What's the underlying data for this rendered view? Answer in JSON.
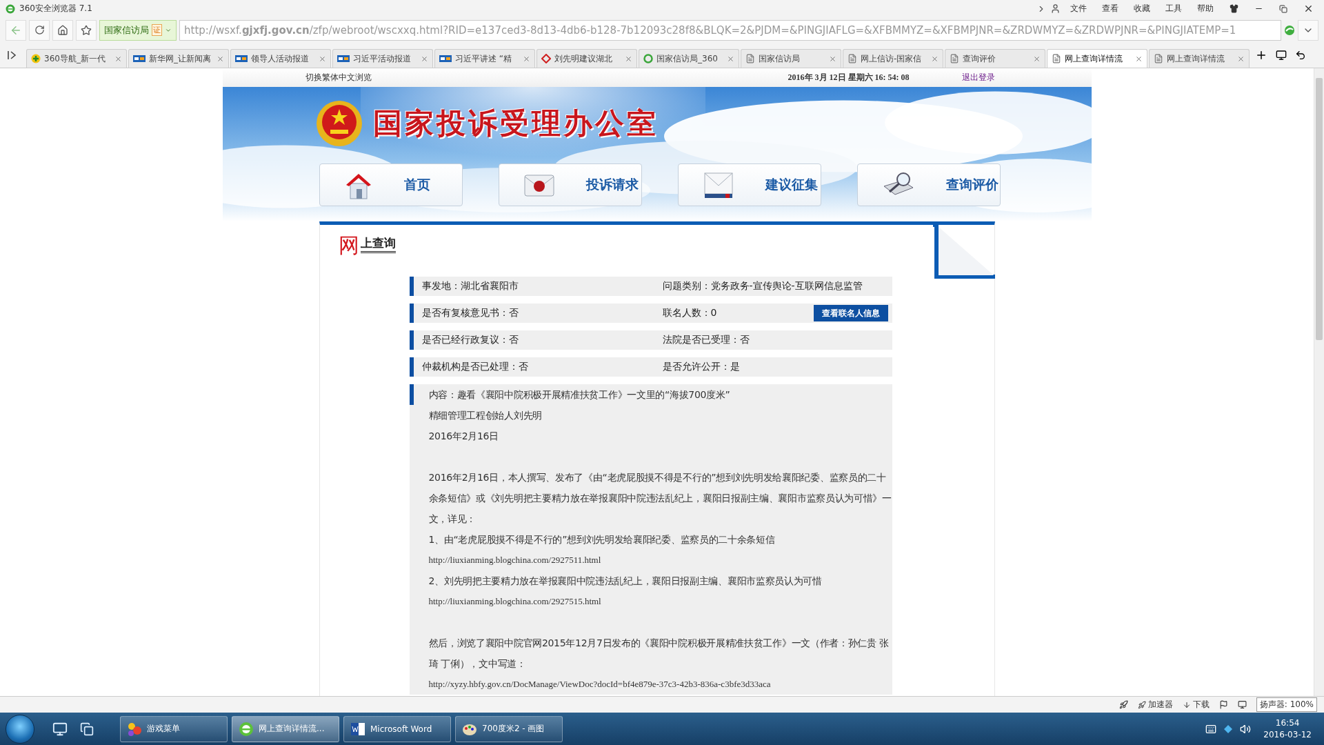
{
  "browser": {
    "title": "360安全浏览器 7.1",
    "menu": [
      "文件",
      "查看",
      "收藏",
      "工具",
      "帮助"
    ],
    "site_badge": "国家信访局",
    "cert": "证",
    "url": "http://wsxf.**gjxfj.gov.cn**/zfp/webroot/wscxxq.html?RID=e137ced3-8d13-4db6-b128-7b12093c28f8&BLQK=2&PJDM=&PINGJIAFLG=&XFBMMYZ=&XFBMPJNR=&ZRDWMYZ=&ZRDWPJNR=&PINGJIATEMP=1"
  },
  "tabs": [
    {
      "label": "360导航_新一代",
      "kind": "plus",
      "selected": false
    },
    {
      "label": "新华网_让新闻离",
      "kind": "news",
      "selected": false
    },
    {
      "label": "领导人活动报道",
      "kind": "news",
      "selected": false
    },
    {
      "label": "习近平活动报道",
      "kind": "news",
      "selected": false
    },
    {
      "label": "习近平讲述 “精",
      "kind": "news",
      "selected": false
    },
    {
      "label": "刘先明建议湖北",
      "kind": "diamond",
      "selected": false
    },
    {
      "label": "国家信访局_360",
      "kind": "ring",
      "selected": false
    },
    {
      "label": "国家信访局",
      "kind": "page",
      "selected": false
    },
    {
      "label": "网上信访-国家信",
      "kind": "page",
      "selected": false
    },
    {
      "label": "查询评价",
      "kind": "page",
      "selected": false
    },
    {
      "label": "网上查询详情流",
      "kind": "page",
      "selected": true
    },
    {
      "label": "网上查询详情流",
      "kind": "page",
      "selected": false
    }
  ],
  "page": {
    "traditional_link": "切换繁体中文浏览",
    "datetime": "2016年 3月 12日 星期六 16: 54: 08",
    "logout": "退出登录",
    "site_title": "国家投诉受理办公室",
    "nav": [
      {
        "label": "首页",
        "kind": "home"
      },
      {
        "label": "投诉请求",
        "kind": "seal"
      },
      {
        "label": "建议征集",
        "kind": "mail"
      },
      {
        "label": "查询评价",
        "kind": "search"
      }
    ],
    "section_mark": "网",
    "section_title": "上查询",
    "info_rows": [
      {
        "left": "事发地：湖北省襄阳市",
        "right": "问题类别：党务政务-宣传舆论-互联网信息监管"
      },
      {
        "left": "是否有复核意见书：否",
        "right": "联名人数：0",
        "button": "查看联名人信息"
      },
      {
        "left": "是否已经行政复议：否",
        "right": "法院是否已受理：否"
      },
      {
        "left": "仲裁机构是否已处理：否",
        "right": "是否允许公开：是"
      }
    ],
    "content": [
      {
        "kind": "text",
        "text": "内容：趣看《襄阳中院积极开展精准扶贫工作》一文里的“海拔700度米”"
      },
      {
        "kind": "text",
        "text": "精细管理工程创始人刘先明"
      },
      {
        "kind": "text",
        "text": "2016年2月16日"
      },
      {
        "kind": "gap"
      },
      {
        "kind": "text",
        "text": "2016年2月16日，本人撰写、发布了《由“老虎屁股摸不得是不行的”想到刘先明发给襄阳纪委、监察员的二十余条短信》或《刘先明把主要精力放在举报襄阳中院违法乱纪上，襄阳日报副主编、襄阳市监察员认为可惜》一文，详见："
      },
      {
        "kind": "text",
        "text": "1、由“老虎屁股摸不得是不行的”想到刘先明发给襄阳纪委、监察员的二十余条短信"
      },
      {
        "kind": "link",
        "text": "http://liuxianming.blogchina.com/2927511.html"
      },
      {
        "kind": "text",
        "text": "2、刘先明把主要精力放在举报襄阳中院违法乱纪上，襄阳日报副主编、襄阳市监察员认为可惜"
      },
      {
        "kind": "link",
        "text": "http://liuxianming.blogchina.com/2927515.html"
      },
      {
        "kind": "gap"
      },
      {
        "kind": "text",
        "text": "然后，浏览了襄阳中院官网2015年12月7日发布的《襄阳中院积极开展精准扶贫工作》一文（作者：孙仁贵 张琦 丁俐），文中写道："
      },
      {
        "kind": "link",
        "text": "http://xyzy.hbfy.gov.cn/DocManage/ViewDoc?docId=bf4e879e-37c3-42b3-836a-c3bfe3d33aca"
      }
    ]
  },
  "status_bar": {
    "accelerator": "加速器",
    "download": "下载",
    "volume": "扬声器: 100%"
  },
  "taskbar": {
    "items": [
      {
        "label": "游戏菜单",
        "kind": "game",
        "selected": false
      },
      {
        "label": "网上查询详情流...",
        "kind": "browser",
        "selected": true
      },
      {
        "label": "Microsoft Word",
        "kind": "word",
        "selected": false
      },
      {
        "label": "700度米2 - 画图",
        "kind": "paint",
        "selected": false
      }
    ],
    "time": "16:54",
    "date": "2016-03-12"
  }
}
